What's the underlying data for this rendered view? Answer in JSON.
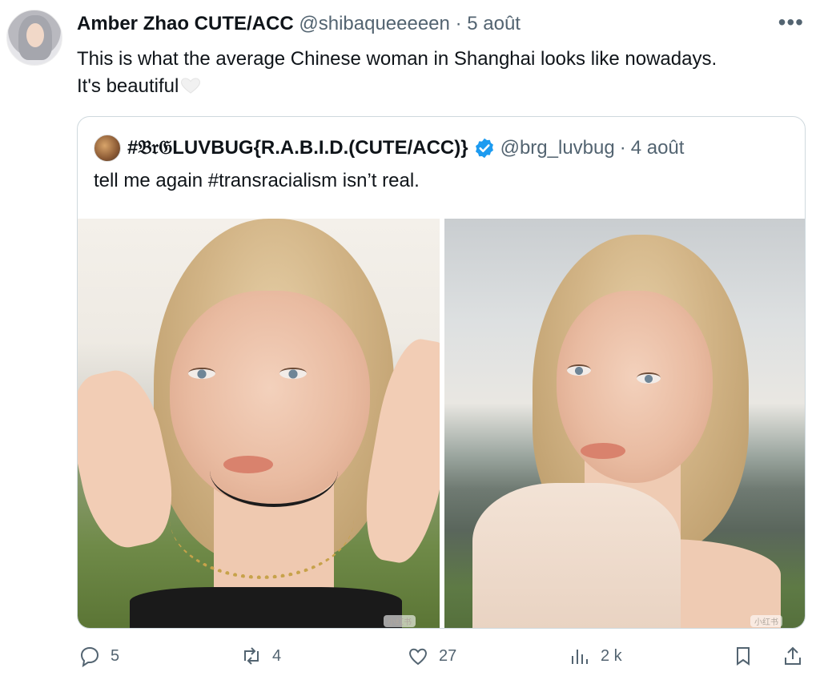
{
  "tweet": {
    "author_name": "Amber Zhao CUTE/ACC",
    "author_handle": "@shibaqueeeeen",
    "separator": "·",
    "date": "5 août",
    "more_icon": "ellipsis-icon",
    "text_line1": "This is what the average Chinese woman in Shanghai looks like nowadays.",
    "text_line2": "It's beautiful",
    "emoji": "white-heart-emoji"
  },
  "quoted_tweet": {
    "author_name": "#𝔅𝔯𝔊LUVBUG{R.A.B.I.D.(CUTE/ACC)}",
    "verified": true,
    "author_handle": "@brg_luvbug",
    "separator": "·",
    "date": "4 août",
    "text": "tell me again #transracialism isn’t real.",
    "photo_watermark_left": "小红书",
    "photo_watermark_right": "小红书"
  },
  "actions": {
    "replies": "5",
    "retweets": "4",
    "likes": "27",
    "views": "2 k"
  },
  "colors": {
    "text": "#0f1419",
    "secondary": "#536471",
    "border": "#cfd9de",
    "verified": "#1d9bf0"
  }
}
